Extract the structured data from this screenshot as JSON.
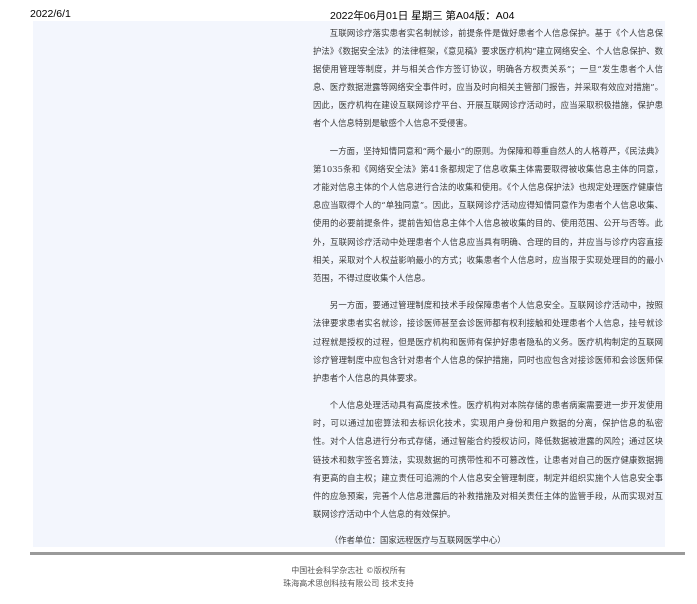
{
  "header": {
    "date": "2022/6/1",
    "issue": "2022年06月01日 星期三 第A04版：A04"
  },
  "article": {
    "paragraphs": [
      "互联网诊疗落实患者实名制就诊，前提条件是做好患者个人信息保护。基于《个人信息保护法》《数据安全法》的法律框架，《意见稿》要求医疗机构“建立网络安全、个人信息保护、数据使用管理等制度，并与相关合作方签订协议，明确各方权责关系”；一旦“发生患者个人信息、医疗数据泄露等网络安全事件时，应当及时向相关主管部门报告，并采取有效应对措施”。因此，医疗机构在建设互联网诊疗平台、开展互联网诊疗活动时，应当采取积极措施，保护患者个人信息特别是敏感个人信息不受侵害。",
      "一方面，坚持知情同意和“两个最小”的原则。为保障和尊重自然人的人格尊严，《民法典》第1035条和《网络安全法》第41条都规定了信息收集主体需要取得被收集信息主体的同意，才能对信息主体的个人信息进行合法的收集和使用。《个人信息保护法》也规定处理医疗健康信息应当取得个人的“单独同意”。因此，互联网诊疗活动应得知情同意作为患者个人信息收集、使用的必要前提条件，提前告知信息主体个人信息被收集的目的、使用范围、公开与否等。此外，互联网诊疗活动中处理患者个人信息应当具有明确、合理的目的，并应当与诊疗内容直接相关，采取对个人权益影响最小的方式；收集患者个人信息时，应当限于实现处理目的的最小范围，不得过度收集个人信息。",
      "另一方面，要通过管理制度和技术手段保障患者个人信息安全。互联网诊疗活动中，按照法律要求患者实名就诊，接诊医师甚至会诊医师都有权利接触和处理患者个人信息，挂号就诊过程就是授权的过程，但是医疗机构和医师有保护好患者隐私的义务。医疗机构制定的互联网诊疗管理制度中应包含针对患者个人信息的保护措施，同时也应包含对接诊医师和会诊医师保护患者个人信息的具体要求。",
      "个人信息处理活动具有高度技术性。医疗机构对本院存储的患者病案需要进一步开发使用时，可以通过加密算法和去标识化技术，实现用户身份和用户数据的分离，保护信息的私密性。对个人信息进行分布式存储，通过智能合约授权访问，降低数据被泄露的风险；通过区块链技术和数字签名算法，实现数据的可携带性和不可篡改性，让患者对自己的医疗健康数据拥有更高的自主权；建立责任可追溯的个人信息安全管理制度，制定并组织实施个人信息安全事件的应急预案，完善个人信息泄露后的补救措施及对相关责任主体的监管手段，从而实现对互联网诊疗活动中个人信息的有效保护。"
    ],
    "author": "（作者单位：国家远程医疗与互联网医学中心）"
  },
  "footer": {
    "line1": "中国社会科学杂志社 ©版权所有",
    "line2": "珠海高术思创科技有限公司 技术支持"
  }
}
